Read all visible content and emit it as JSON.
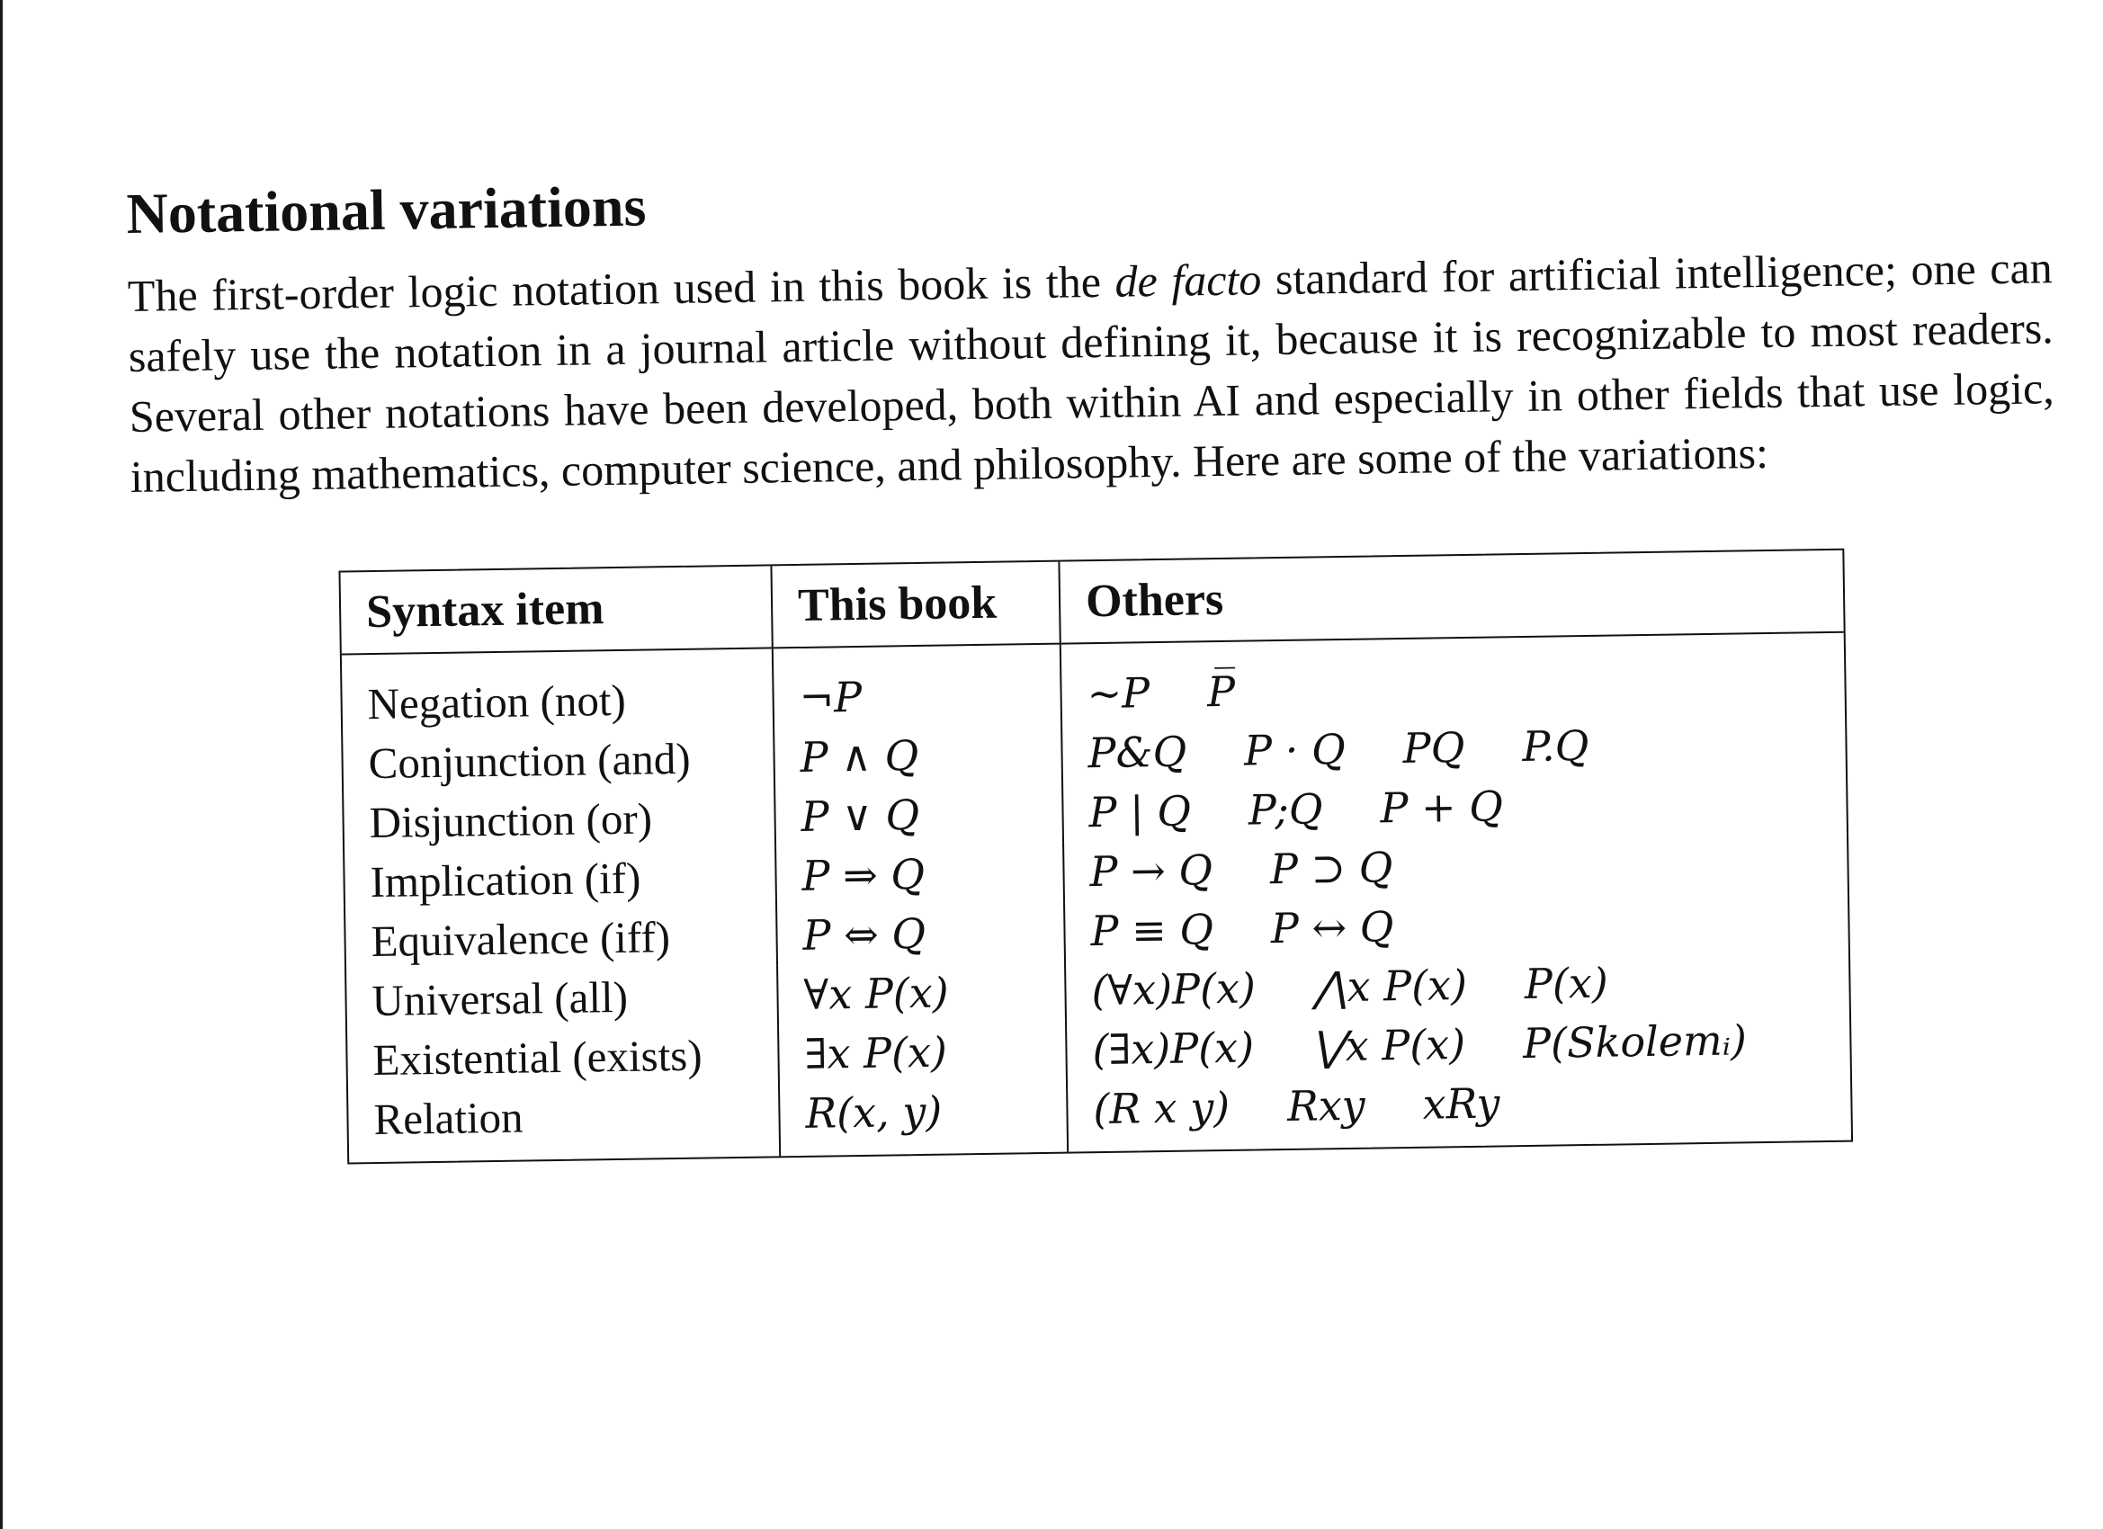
{
  "section": {
    "heading": "Notational variations",
    "paragraph": {
      "before_emphasis": "The first-order logic notation used in this book is the ",
      "emphasis": "de facto",
      "after_emphasis": " standard for artificial intelligence; one can safely use the notation in a journal article without defining it, because it is recognizable to most readers.  Several other notations have been developed, both within AI and especially in other fields that use logic, including mathematics, computer science, and philosophy.  Here are some of the variations:"
    }
  },
  "table": {
    "headers": {
      "syntax_item": "Syntax item",
      "this_book": "This book",
      "others": "Others"
    },
    "rows": [
      {
        "item": "Negation (not)",
        "this_book": "¬P",
        "others": [
          "~P",
          "P̅"
        ]
      },
      {
        "item": "Conjunction (and)",
        "this_book": "P ∧ Q",
        "others": [
          "P&Q",
          "P · Q",
          "PQ",
          "P.Q"
        ]
      },
      {
        "item": "Disjunction (or)",
        "this_book": "P ∨ Q",
        "others": [
          "P | Q",
          "P;Q",
          "P + Q"
        ]
      },
      {
        "item": "Implication (if)",
        "this_book": "P ⇒ Q",
        "others": [
          "P → Q",
          "P ⊃ Q"
        ]
      },
      {
        "item": "Equivalence (iff)",
        "this_book": "P ⇔ Q",
        "others": [
          "P ≡ Q",
          "P ↔ Q"
        ]
      },
      {
        "item": "Universal (all)",
        "this_book": "∀x  P(x)",
        "others": [
          "(∀x)P(x)",
          "⋀x P(x)",
          "P(x)"
        ]
      },
      {
        "item": "Existential (exists)",
        "this_book": "∃x  P(x)",
        "others": [
          "(∃x)P(x)",
          "⋁x P(x)",
          "P(Skolemᵢ)"
        ]
      },
      {
        "item": "Relation",
        "this_book": "R(x, y)",
        "others": [
          "(R x y)",
          "Rxy",
          "xRy"
        ]
      }
    ]
  }
}
